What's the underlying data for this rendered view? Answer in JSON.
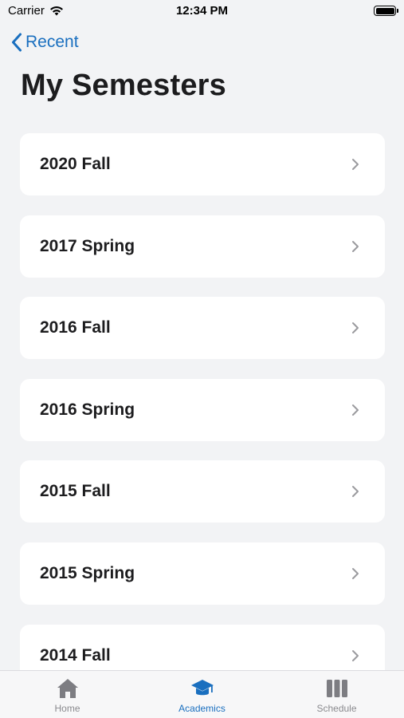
{
  "status_bar": {
    "carrier": "Carrier",
    "time": "12:34 PM"
  },
  "nav": {
    "back_label": "Recent"
  },
  "page": {
    "title": "My Semesters"
  },
  "semesters": [
    {
      "label": "2020 Fall"
    },
    {
      "label": "2017 Spring"
    },
    {
      "label": "2016 Fall"
    },
    {
      "label": "2016 Spring"
    },
    {
      "label": "2015 Fall"
    },
    {
      "label": "2015 Spring"
    },
    {
      "label": "2014 Fall"
    }
  ],
  "tab_bar": {
    "tabs": [
      {
        "label": "Home",
        "icon": "home-icon",
        "active": false
      },
      {
        "label": "Academics",
        "icon": "graduation-cap-icon",
        "active": true
      },
      {
        "label": "Schedule",
        "icon": "schedule-columns-icon",
        "active": false
      }
    ]
  },
  "colors": {
    "accent": "#1a6fbf",
    "background": "#f2f3f5",
    "inactive": "#8a8a8e"
  }
}
